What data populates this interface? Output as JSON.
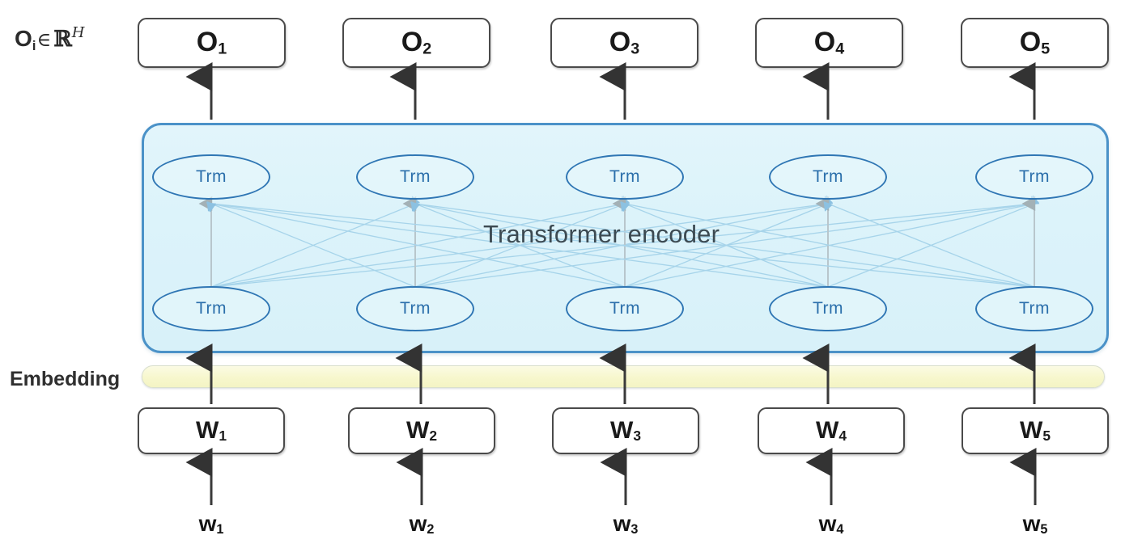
{
  "diagram": {
    "title_text": "Transformer encoder",
    "embedding_label": "Embedding",
    "formula": {
      "symbol": "O",
      "subscript": "i",
      "member_of": "∈",
      "set": "ℝ",
      "superscript": "H",
      "full": "Oᵢ ∈ ℝᴴ"
    },
    "colors": {
      "encoder_border": "#4b92c8",
      "encoder_fill": "#dcf3fa",
      "node_border": "#2f76b4",
      "node_text": "#2b6fab",
      "box_border": "#4a4a4a",
      "embedding_fill": "#f7f7cd",
      "arrow": "#3a3a3a",
      "attention_line": "#9ecfe8",
      "title_text": "#3c4a52"
    },
    "outputs": [
      {
        "label": "O",
        "index": "1"
      },
      {
        "label": "O",
        "index": "2"
      },
      {
        "label": "O",
        "index": "3"
      },
      {
        "label": "O",
        "index": "4"
      },
      {
        "label": "O",
        "index": "5"
      }
    ],
    "word_boxes": [
      {
        "label": "W",
        "index": "1"
      },
      {
        "label": "W",
        "index": "2"
      },
      {
        "label": "W",
        "index": "3"
      },
      {
        "label": "W",
        "index": "4"
      },
      {
        "label": "W",
        "index": "5"
      }
    ],
    "word_inputs": [
      {
        "label": "w",
        "index": "1"
      },
      {
        "label": "w",
        "index": "2"
      },
      {
        "label": "w",
        "index": "3"
      },
      {
        "label": "w",
        "index": "4"
      },
      {
        "label": "w",
        "index": "5"
      }
    ],
    "transformer_nodes_top": [
      "Trm",
      "Trm",
      "Trm",
      "Trm",
      "Trm"
    ],
    "transformer_nodes_bottom": [
      "Trm",
      "Trm",
      "Trm",
      "Trm",
      "Trm"
    ],
    "layers": 2,
    "sequence_length": 5
  }
}
